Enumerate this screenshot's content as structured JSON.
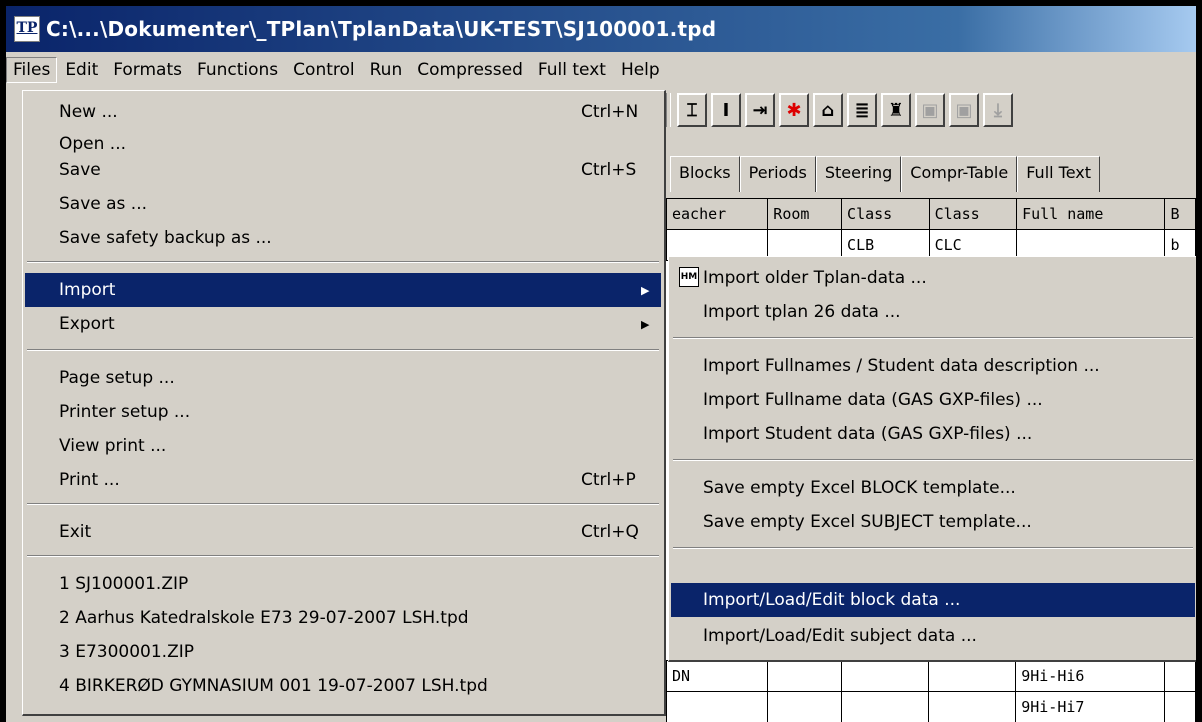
{
  "window": {
    "title": "C:\\...\\Dokumenter\\_TPlan\\TplanData\\UK-TEST\\SJ100001.tpd",
    "app_icon": "TP"
  },
  "menubar": [
    "Files",
    "Edit",
    "Formats",
    "Functions",
    "Control",
    "Run",
    "Compressed",
    "Full text",
    "Help"
  ],
  "tabs": [
    "Blocks",
    "Periods",
    "Steering",
    "Compr-Table",
    "Full Text"
  ],
  "grid": {
    "headers": [
      "eacher",
      "Room",
      "Class",
      "Class",
      "Full name",
      "B"
    ],
    "row1": [
      "",
      "",
      "CLB",
      "CLC",
      "",
      "b"
    ],
    "row_bottom1": [
      "DN",
      "",
      "",
      "",
      "9Hi-Hi6",
      ""
    ],
    "row_bottom2": [
      "",
      "",
      "",
      "",
      "9Hi-Hi7",
      ""
    ]
  },
  "files_menu": {
    "new": "New ...",
    "new_sc": "Ctrl+N",
    "open": "Open ...",
    "save": "Save",
    "save_sc": "Ctrl+S",
    "save_as": "Save as ...",
    "save_backup": "Save safety backup as ...",
    "import": "Import",
    "export": "Export",
    "page_setup": "Page setup ...",
    "printer_setup": "Printer setup ...",
    "view_print": "View print ...",
    "print": "Print ...",
    "print_sc": "Ctrl+P",
    "exit": "Exit",
    "exit_sc": "Ctrl+Q",
    "recent1": "1  SJ100001.ZIP",
    "recent2": "2  Aarhus Katedralskole E73 29-07-2007 LSH.tpd",
    "recent3": "3  E7300001.ZIP",
    "recent4": "4  BIRKERØD GYMNASIUM 001 19-07-2007 LSH.tpd"
  },
  "import_menu": {
    "older_icon": "HM",
    "older": "Import older Tplan-data ...",
    "tplan26": "Import tplan 26 data ...",
    "fullnames": "Import Fullnames / Student data description ...",
    "fullname_gas": "Import Fullname data (GAS GXP-files) ...",
    "student_gas": "Import Student data (GAS GXP-files) ...",
    "excel_block": "Save empty Excel BLOCK template...",
    "excel_subject": "Save empty Excel SUBJECT template...",
    "block_data": "Import/Load/Edit block data ...",
    "subject_data": "Import/Load/Edit subject data ..."
  }
}
